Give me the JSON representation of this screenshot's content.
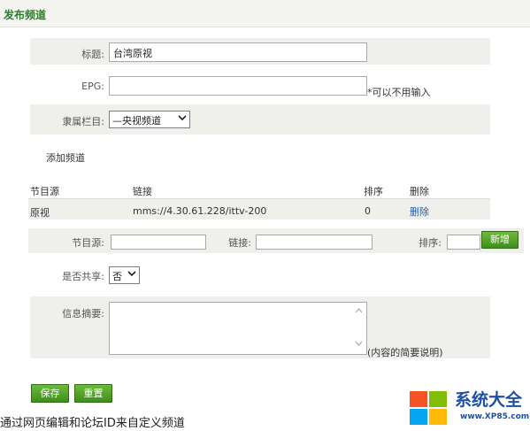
{
  "page": {
    "title": "发布频道"
  },
  "form": {
    "title_label": "标题:",
    "title_value": "台湾原视",
    "epg_label": "EPG:",
    "epg_value": "",
    "epg_hint": "*可以不用输入",
    "category_label": "隶属栏目:",
    "category_value": "—央视频道"
  },
  "add_channel": {
    "section_title": "添加频道",
    "headers": {
      "source": "节目源",
      "link": "链接",
      "order": "排序",
      "delete": "删除"
    },
    "rows": [
      {
        "source": "原视",
        "link": "mms://4.30.61.228/ittv-200",
        "order": "0",
        "delete": "删除"
      }
    ],
    "new_row": {
      "source_label": "节目源:",
      "link_label": "链接:",
      "order_label": "排序:",
      "add_button": "新增"
    }
  },
  "share": {
    "label": "是否共享:",
    "value": "否"
  },
  "summary": {
    "label": "信息摘要:",
    "hint": "(内容的简要说明)"
  },
  "actions": {
    "save": "保存",
    "reset": "重置"
  },
  "caption": "通过网页编辑和论坛ID来自定义频道",
  "watermark": {
    "name": "系统大全",
    "url": "www.XP85.com"
  },
  "colors": {
    "accent_green": "#4a9a23",
    "title_green": "#2d7d2d",
    "link_blue": "#1a5fb4"
  }
}
